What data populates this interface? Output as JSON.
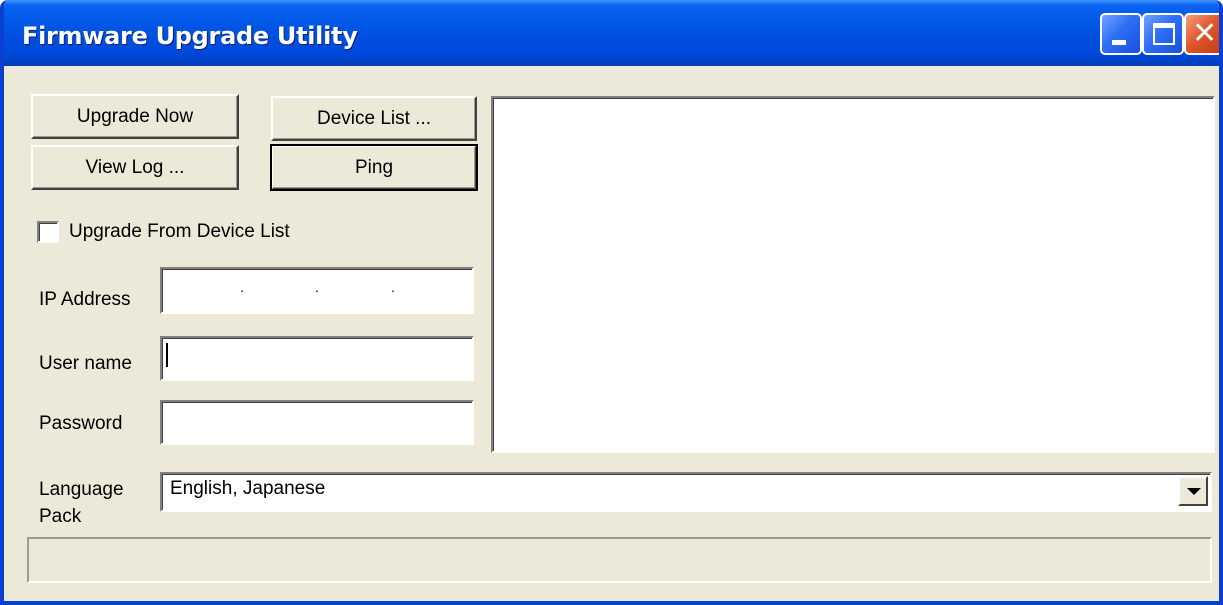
{
  "window": {
    "title": "Firmware Upgrade Utility",
    "controls": {
      "minimize": "minimize-icon",
      "maximize": "maximize-icon",
      "close": "close-icon"
    }
  },
  "buttons": {
    "upgrade_now": "Upgrade Now",
    "device_list": "Device List ...",
    "view_log": "View Log ...",
    "ping": "Ping"
  },
  "checkbox": {
    "label": "Upgrade From Device List",
    "checked": false
  },
  "fields": {
    "ip_address_label": "IP Address",
    "user_name_label": "User name",
    "password_label": "Password",
    "ip_address_value": "",
    "user_name_value": "",
    "password_value": ""
  },
  "language": {
    "label_line1": "Language",
    "label_line2": "Pack",
    "selected": "English, Japanese"
  },
  "status_text": "",
  "colors": {
    "titlebar": "#0054e3",
    "window_bg": "#ece9d8",
    "close_button": "#e0572c"
  }
}
